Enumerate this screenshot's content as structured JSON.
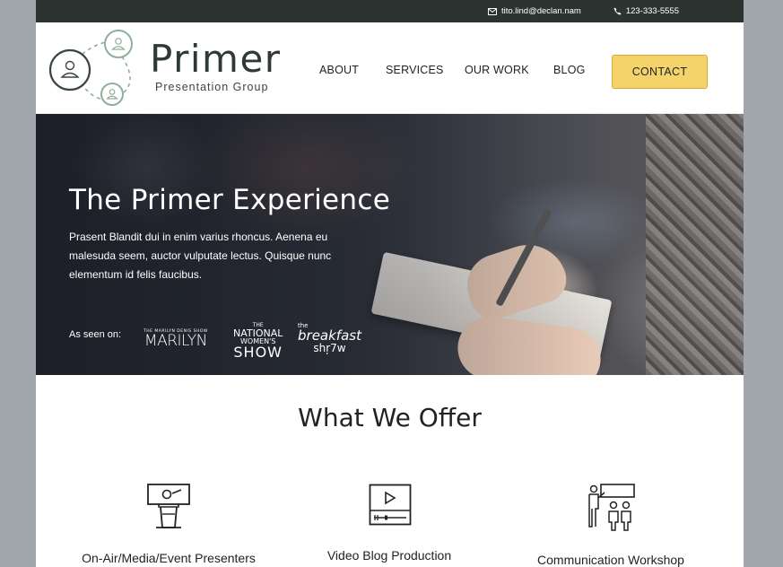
{
  "topbar": {
    "email": "tito.lind@declan.nam",
    "phone": "123-333-5555",
    "email_icon": "envelope-icon",
    "phone_icon": "phone-icon"
  },
  "brand": {
    "name": "Primer",
    "tagline": "Presentation Group",
    "logo_icon": "people-network-icon"
  },
  "nav": {
    "items": [
      "ABOUT",
      "SERVICES",
      "OUR WORK",
      "BLOG"
    ],
    "contact_label": "CONTACT"
  },
  "hero": {
    "title": "The Primer Experience",
    "text": "Prasent Blandit dui in enim varius rhoncus. Aenena eu malesuda seem, auctor vulputate lectus. Quisque nunc elementum id felis faucibus.",
    "seen_on_label": "As seen on:",
    "logos": {
      "marilyn_small": "THE MARILYN DENIS SHOW",
      "marilyn_big": "MARILYN",
      "nws_a": "THE",
      "nws_b": "NATIONAL",
      "nws_c": "WOMEN'S",
      "nws_d": "SHOW",
      "bf_a": "the",
      "bf_b": "breakfast",
      "bf_c": "shŗ7w"
    }
  },
  "offer": {
    "title": "What We Offer",
    "services": [
      {
        "label": "On-Air/Media/Event Presenters",
        "icon": "presenter-podium-icon"
      },
      {
        "label": "Video Blog Production",
        "icon": "video-player-icon"
      },
      {
        "label": "Communication Workshop",
        "icon": "workshop-group-icon"
      }
    ]
  },
  "colors": {
    "topbar": "#2c3431",
    "accent": "#f5d36b",
    "brand_text": "#2f3a34",
    "logo_green": "#8fae9c"
  }
}
